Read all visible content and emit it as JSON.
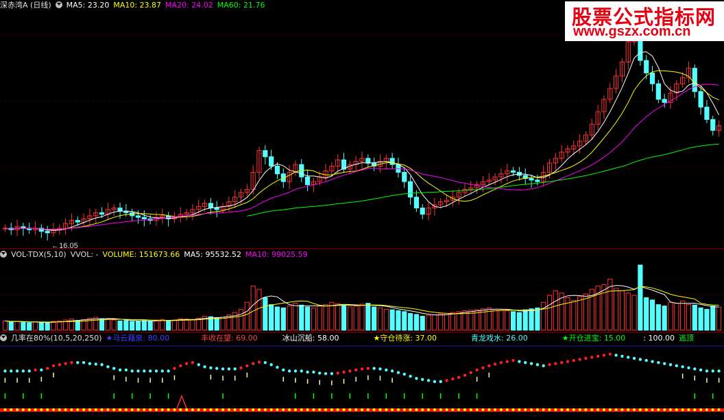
{
  "header1": {
    "title": "深赤湾A (日线)",
    "ma5": "MA5: 23.20",
    "ma10": "MA10: 23.87",
    "ma20": "MA20: 24.02",
    "ma60": "MA60: 21.76"
  },
  "header2": {
    "title": "VOL-TDX(5,10)",
    "vvol": "VVOL: -",
    "volume": "VOLUME: 151673.66",
    "ma5": "MA5: 95532.52",
    "ma10": "MA10: 99025.59"
  },
  "header3": {
    "title": "几率在80%(10,5,20,250)",
    "s1": "★马云藉泉: 80.00",
    "s2": "丰收在望: 69.00",
    "s3": "冰山沉船: 58.00",
    "s4": "★守仓待涨: 37.00",
    "s5": "青龙戏水: 26.00",
    "s6": "★开仓进宝: 15.00",
    "s7": ": 100.00",
    "s8": "逃顶"
  },
  "watermark": {
    "line1": "股票公式指标网",
    "line2": "www.gszx.com.cn"
  },
  "colors": {
    "up": "#ff3232",
    "down": "#54ffff",
    "ma5": "#ffffff",
    "ma10": "#ffff00",
    "ma20": "#ff00ff",
    "ma60": "#00ff00",
    "divider": "#a00000"
  },
  "chart_data": [
    {
      "type": "candlestick",
      "title": "深赤湾A (日线)",
      "min_label": "16.05",
      "close_series": [
        16.6,
        16.5,
        16.7,
        16.6,
        16.5,
        16.6,
        16.4,
        16.3,
        16.5,
        16.6,
        16.9,
        17.1,
        17.0,
        17.2,
        17.4,
        17.6,
        17.5,
        17.8,
        17.9,
        17.7,
        17.6,
        17.4,
        17.3,
        17.2,
        17.1,
        17.3,
        17.4,
        17.2,
        17.3,
        17.5,
        17.6,
        17.8,
        18.0,
        18.2,
        17.9,
        17.8,
        18.0,
        18.3,
        18.6,
        18.9,
        19.1,
        20.2,
        21.6,
        21.2,
        20.6,
        20.1,
        19.6,
        20.2,
        20.7,
        19.9,
        19.4,
        19.6,
        19.9,
        20.3,
        20.6,
        21.0,
        20.4,
        20.7,
        20.9,
        21.1,
        20.8,
        20.6,
        20.9,
        21.1,
        20.7,
        20.2,
        19.6,
        18.6,
        17.9,
        17.5,
        17.9,
        18.1,
        18.3,
        18.4,
        18.6,
        18.9,
        19.1,
        19.2,
        19.4,
        19.6,
        19.7,
        19.9,
        20.1,
        20.3,
        20.2,
        20.0,
        19.8,
        19.7,
        19.6,
        20.2,
        20.8,
        21.1,
        21.5,
        21.7,
        21.9,
        22.2,
        22.6,
        23.3,
        24.1,
        24.9,
        25.6,
        26.4,
        27.3,
        28.6,
        29.9,
        27.4,
        26.6,
        25.9,
        24.9,
        24.7,
        25.3,
        25.9,
        26.3,
        26.9,
        25.4,
        24.4,
        23.6,
        22.9,
        23.2
      ],
      "ylim": [
        15.5,
        30.5
      ]
    },
    {
      "type": "bar",
      "title": "VOL-TDX(5,10)",
      "values": [
        20,
        18,
        19,
        17,
        16,
        18,
        17,
        16,
        19,
        20,
        22,
        24,
        21,
        23,
        26,
        28,
        25,
        24,
        22,
        20,
        21,
        19,
        20,
        21,
        19,
        22,
        23,
        21,
        22,
        25,
        24,
        23,
        26,
        30,
        29,
        27,
        28,
        33,
        38,
        45,
        60,
        95,
        88,
        70,
        55,
        50,
        48,
        52,
        58,
        54,
        50,
        48,
        52,
        55,
        60,
        57,
        53,
        50,
        52,
        56,
        58,
        50,
        48,
        45,
        44,
        42,
        40,
        36,
        34,
        30,
        32,
        33,
        35,
        36,
        38,
        40,
        42,
        43,
        44,
        46,
        48,
        45,
        43,
        42,
        40,
        38,
        44,
        46,
        48,
        60,
        75,
        85,
        80,
        70,
        64,
        72,
        78,
        88,
        95,
        98,
        110,
        90,
        85,
        80,
        75,
        140,
        70,
        65,
        55,
        52,
        60,
        58,
        63,
        55,
        54,
        48,
        45,
        52,
        50
      ],
      "ylim": [
        0,
        150
      ]
    },
    {
      "type": "line",
      "title": "几率在80%(10,5,20,250)",
      "series_name": "",
      "values": [
        50,
        50,
        50,
        50,
        50,
        52,
        52,
        55,
        60,
        62,
        64,
        66,
        66,
        66,
        64,
        63,
        62,
        58,
        55,
        52,
        52,
        50,
        50,
        50,
        50,
        50,
        50,
        50,
        55,
        60,
        64,
        66,
        62,
        58,
        56,
        55,
        54,
        54,
        54,
        56,
        60,
        64,
        67,
        66,
        62,
        57,
        52,
        50,
        50,
        50,
        48,
        48,
        46,
        45,
        45,
        46,
        48,
        50,
        52,
        54,
        55,
        55,
        54,
        52,
        50,
        47,
        44,
        40,
        36,
        34,
        32,
        30,
        30,
        32,
        35,
        38,
        42,
        47,
        52,
        56,
        60,
        63,
        66,
        68,
        70,
        68,
        66,
        64,
        62,
        60,
        62,
        64,
        66,
        68,
        70,
        72,
        74,
        76,
        78,
        80,
        82,
        80,
        78,
        76,
        74,
        72,
        70,
        68,
        66,
        64,
        62,
        60,
        58,
        56,
        54,
        52,
        50,
        50,
        50,
        50
      ],
      "ylim": [
        0,
        100
      ]
    }
  ]
}
